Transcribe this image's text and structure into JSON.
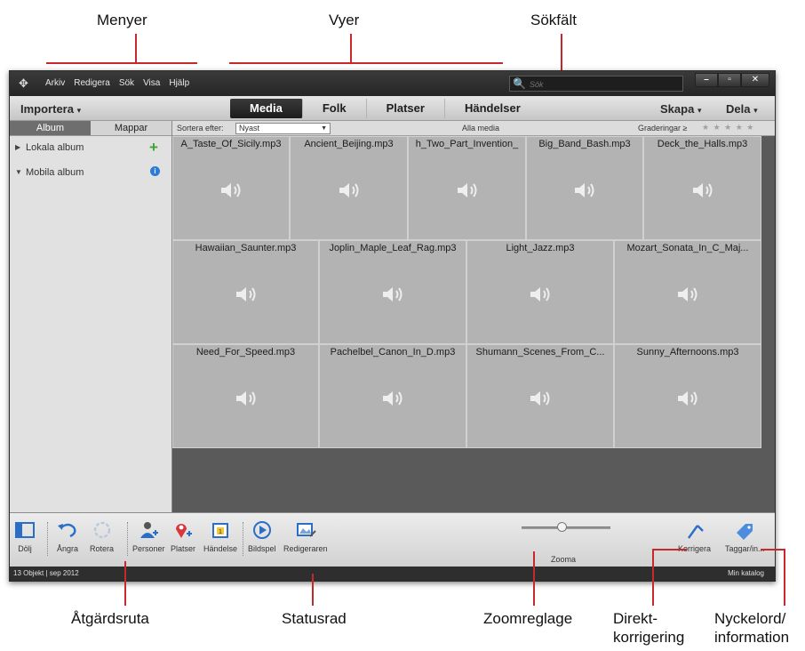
{
  "annotations": {
    "menyer": "Menyer",
    "vyer": "Vyer",
    "sokfalt": "Sökfält",
    "atgardsruta": "Åtgärdsruta",
    "statusrad": "Statusrad",
    "zoomreglage": "Zoomreglage",
    "direkt_1": "Direkt-",
    "direkt_2": "korrigering",
    "nyckel_1": "Nyckelord/",
    "nyckel_2": "information"
  },
  "menu": [
    "Arkiv",
    "Redigera",
    "Sök",
    "Visa",
    "Hjälp"
  ],
  "search": {
    "placeholder": "Sök"
  },
  "window_buttons": [
    "–",
    "▫",
    "✕"
  ],
  "toolbar": {
    "import": "Importera",
    "views": [
      "Media",
      "Folk",
      "Platser",
      "Händelser"
    ],
    "active_view": "Media",
    "create": "Skapa",
    "share": "Dela"
  },
  "sidebar": {
    "tabs": [
      "Album",
      "Mappar"
    ],
    "active_tab": "Album",
    "items": [
      {
        "label": "Lokala album"
      },
      {
        "label": "Mobila album"
      }
    ]
  },
  "sortbar": {
    "sort_label": "Sortera efter:",
    "sort_value": "Nyast",
    "all_media": "Alla media",
    "ratings_label": "Graderingar",
    "ratings_symbol": "≥",
    "stars": "★ ★ ★ ★ ★"
  },
  "media_rows": [
    [
      "A_Taste_Of_Sicily.mp3",
      "Ancient_Beijing.mp3",
      "h_Two_Part_Invention_",
      "Big_Band_Bash.mp3",
      "Deck_the_Halls.mp3"
    ],
    [
      "Hawaiian_Saunter.mp3",
      "Joplin_Maple_Leaf_Rag.mp3",
      "Light_Jazz.mp3",
      "Mozart_Sonata_In_C_Maj..."
    ],
    [
      "Need_For_Speed.mp3",
      "Pachelbel_Canon_In_D.mp3",
      "Shumann_Scenes_From_C...",
      "Sunny_Afternoons.mp3"
    ]
  ],
  "actions": {
    "hide": "Dölj",
    "undo": "Ångra",
    "rotate": "Rotera",
    "people": "Personer",
    "places": "Platser",
    "event": "Händelse",
    "slideshow": "Bildspel",
    "editor": "Redigeraren",
    "zoom": "Zooma",
    "zoom_level": 0.45,
    "fix": "Korrigera",
    "tags": "Taggar/in..."
  },
  "status": {
    "left": "13 Objekt | sep 2012",
    "right": "Min katalog"
  },
  "colors": {
    "annotation_line": "#c8282c",
    "active_view_bg": "#262626",
    "cell_bg": "#b3b3b3"
  }
}
